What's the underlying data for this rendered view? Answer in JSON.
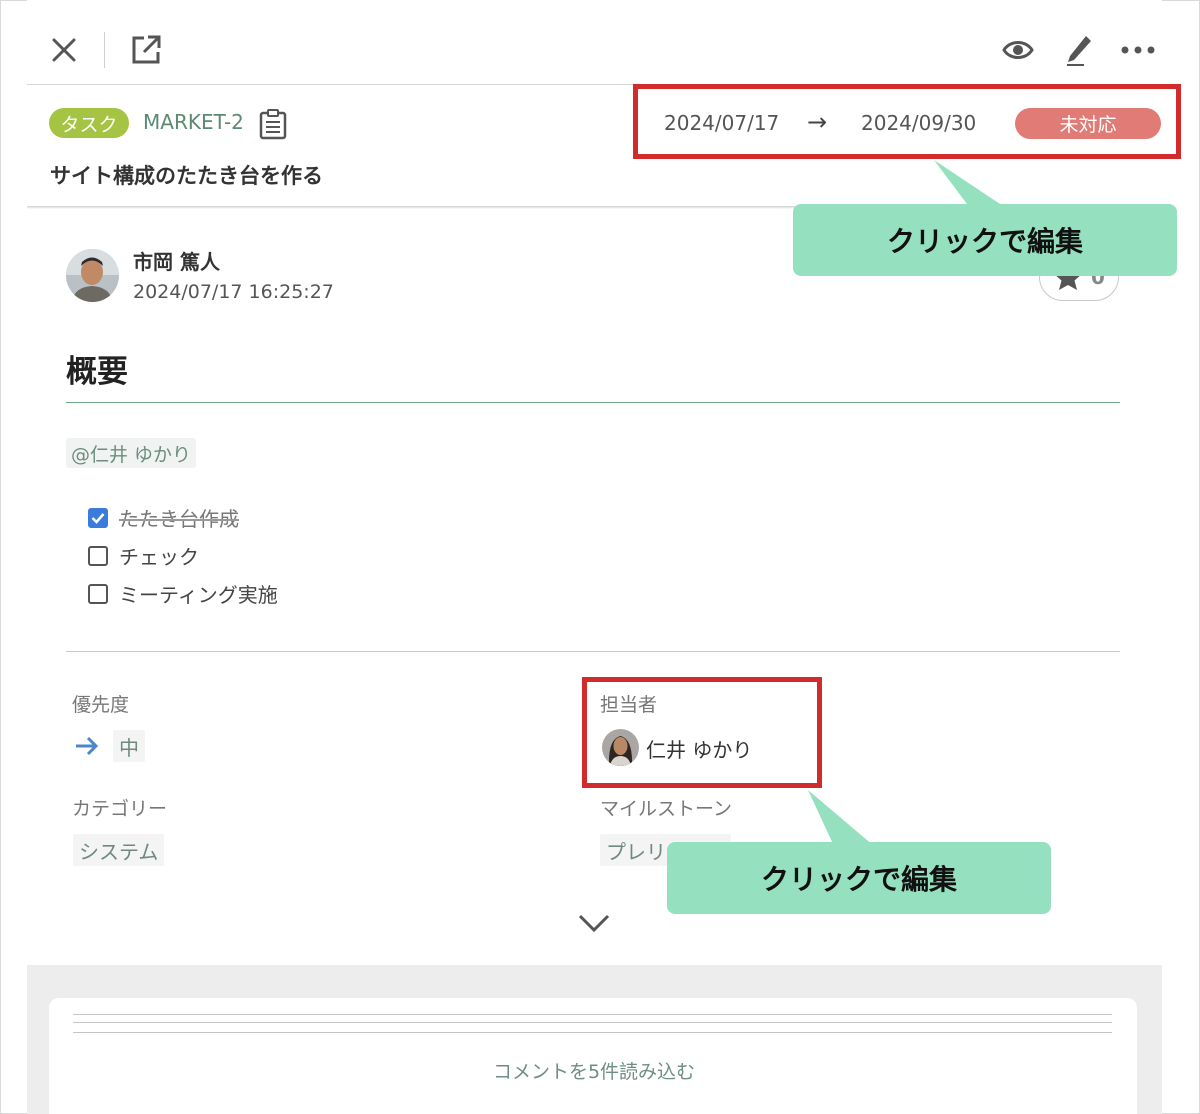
{
  "toolbar": {
    "close_icon": "close-icon",
    "open_icon": "external-link-icon",
    "watch_icon": "eye-icon",
    "edit_icon": "pen-icon",
    "more_icon": "more-icon"
  },
  "issue": {
    "type": "タスク",
    "key": "MARKET-2",
    "title": "サイト構成のたたき台を作る",
    "start_date": "2024/07/17",
    "arrow": "→",
    "due_date": "2024/09/30",
    "status": "未対応"
  },
  "callouts": {
    "dates": "クリックで編集",
    "assignee": "クリックで編集"
  },
  "author": {
    "name": "市岡 篤人",
    "timestamp": "2024/07/17 16:25:27",
    "star_count": "0"
  },
  "summary": {
    "heading": "概要",
    "mention": "@仁井 ゆかり",
    "checklist": [
      {
        "label": "たたき台作成",
        "checked": true
      },
      {
        "label": "チェック",
        "checked": false
      },
      {
        "label": "ミーティング実施",
        "checked": false
      }
    ]
  },
  "properties": {
    "priority_label": "優先度",
    "priority_value": "中",
    "assignee_label": "担当者",
    "assignee_value": "仁井 ゆかり",
    "category_label": "カテゴリー",
    "category_value": "システム",
    "milestone_label": "マイルストーン",
    "milestone_value": "プレリリース"
  },
  "comments": {
    "load_more": "コメントを5件読み込む"
  },
  "colors": {
    "type_badge": "#a6c444",
    "status_badge": "#e07b76",
    "highlight": "#d12b2b",
    "callout": "#94e0bf"
  }
}
